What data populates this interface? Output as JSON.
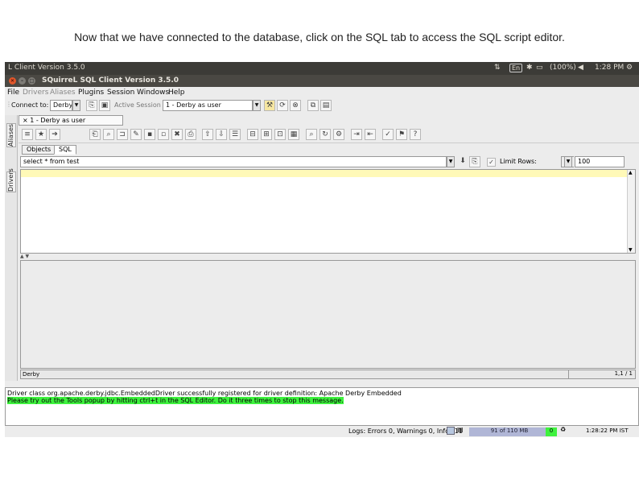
{
  "caption": "Now that we have connected to the database, click on the SQL tab to access the SQL script editor.",
  "system_bar": {
    "app_name": "L Client Version 3.5.0",
    "keyboard": "En",
    "battery": "(100%)",
    "clock": "1:28 PM"
  },
  "window": {
    "title": "SQuirreL SQL Client Version 3.5.0"
  },
  "menu": [
    "File",
    "Drivers",
    "Aliases",
    "Plugins",
    "Session",
    "Windows",
    "Help"
  ],
  "toolbar": {
    "connect_label": "Connect to:",
    "connect_value": "Derby",
    "active_session_label": "Active Session",
    "active_session_value": "1 - Derby  as  user"
  },
  "side_tabs": [
    "Aliases",
    "Drivers"
  ],
  "session_tab": "1 - Derby  as  user",
  "sub_tabs": [
    "Objects",
    "SQL"
  ],
  "sql": {
    "history_value": "select * from test",
    "limit_rows_label": "Limit Rows:",
    "limit_rows_value": "100"
  },
  "editor_status": {
    "left": "Derby",
    "right": "1,1 / 1"
  },
  "log_lines": [
    "Driver class org.apache.derby.jdbc.EmbeddedDriver successfully registered for driver definition: Apache Derby Embedded",
    "Please try out the Tools popup by hitting ctrl+t in the SQL Editor. Do it three times to stop this message."
  ],
  "footer": {
    "logs": "Logs: Errors 0, Warnings 0, Infos 11",
    "memory": "91 of 110 MB",
    "gc_label": "0",
    "time": "1:28:22 PM IST"
  },
  "colors": {
    "highlight_line": "#fff9b8",
    "log_highlight": "#3ef23e",
    "memory_bar": "#b0b6d6"
  }
}
